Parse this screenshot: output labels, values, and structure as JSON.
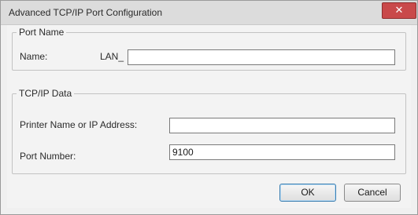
{
  "window": {
    "title": "Advanced TCP/IP Port Configuration",
    "close_glyph": "✕"
  },
  "port_name_group": {
    "legend": "Port Name",
    "name_label": "Name:",
    "name_value": "LAN_"
  },
  "tcpip_group": {
    "legend": "TCP/IP Data",
    "address_label": "Printer Name or IP Address:",
    "address_value": "",
    "port_label": "Port Number:",
    "port_value": "9100"
  },
  "buttons": {
    "ok": "OK",
    "cancel": "Cancel"
  },
  "colors": {
    "close_button": "#c9494a",
    "default_button_border": "#3c7fb1"
  }
}
